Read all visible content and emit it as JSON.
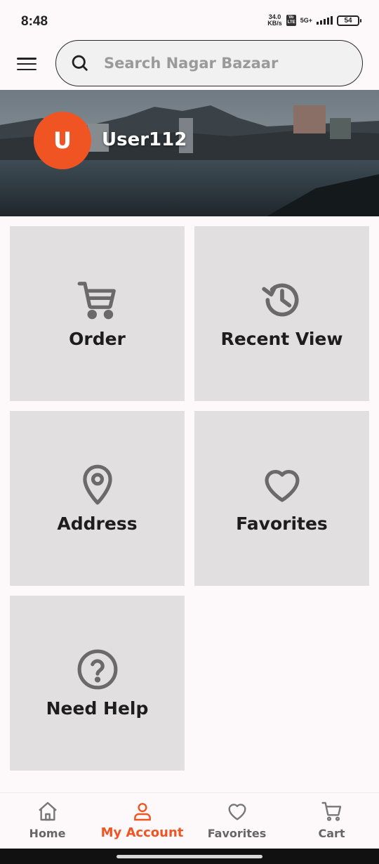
{
  "status_bar": {
    "time": "8:48",
    "net_speed_value": "34.0",
    "net_speed_unit": "KB/s",
    "volte": "Vo LTE",
    "net_type": "5G+",
    "battery": "54"
  },
  "header": {
    "search_placeholder": "Search Nagar Bazaar"
  },
  "profile": {
    "avatar_initial": "U",
    "user_name": "User112"
  },
  "tiles": [
    {
      "label": "Order",
      "icon": "cart-icon"
    },
    {
      "label": "Recent View",
      "icon": "history-icon"
    },
    {
      "label": "Address",
      "icon": "location-pin-icon"
    },
    {
      "label": "Favorites",
      "icon": "heart-icon"
    },
    {
      "label": "Need Help",
      "icon": "help-circle-icon"
    }
  ],
  "bottom_nav": {
    "items": [
      {
        "label": "Home",
        "icon": "home-icon"
      },
      {
        "label": "My Account",
        "icon": "user-icon",
        "active": true
      },
      {
        "label": "Favorites",
        "icon": "heart-icon"
      },
      {
        "label": "Cart",
        "icon": "cart-icon"
      }
    ]
  },
  "colors": {
    "accent": "#f05423",
    "tile_bg": "#e2dfe1",
    "background": "#fdf9fb"
  }
}
